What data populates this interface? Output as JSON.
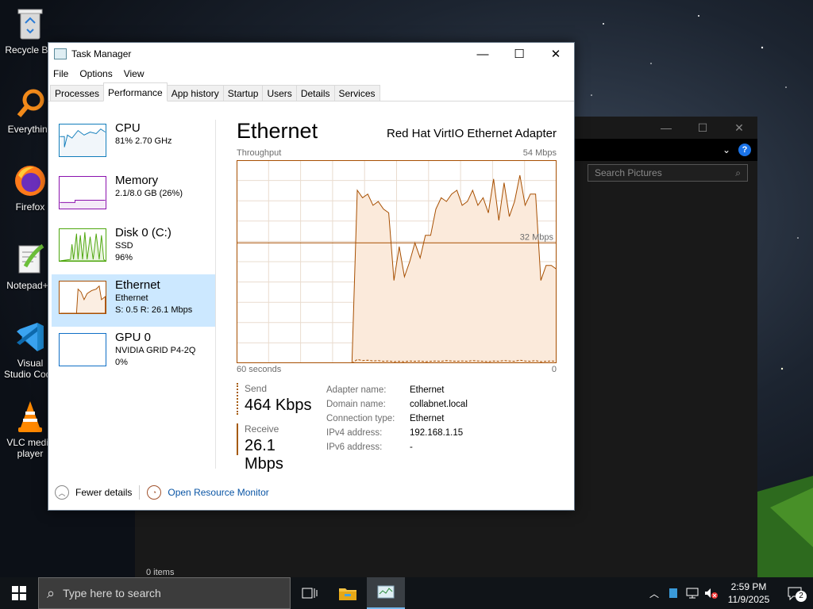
{
  "desktop": {
    "icons": [
      {
        "label": "Recycle Bin",
        "icon": "recycle-bin-icon"
      },
      {
        "label": "Everything",
        "icon": "everything-search-icon"
      },
      {
        "label": "Firefox",
        "icon": "firefox-icon"
      },
      {
        "label": "Notepad++",
        "icon": "notepad-plus-plus-icon"
      },
      {
        "label": "Visual Studio Code",
        "icon": "vscode-icon"
      },
      {
        "label": "VLC media player",
        "icon": "vlc-icon"
      }
    ]
  },
  "background_window": {
    "search_placeholder": "Search Pictures",
    "status": "0 items"
  },
  "task_manager": {
    "title": "Task Manager",
    "menu": [
      "File",
      "Options",
      "View"
    ],
    "tabs": [
      "Processes",
      "Performance",
      "App history",
      "Startup",
      "Users",
      "Details",
      "Services"
    ],
    "active_tab": "Performance",
    "sidebar": [
      {
        "name": "CPU",
        "line1": "81% 2.70 GHz",
        "line2": "",
        "color": "#117dbb"
      },
      {
        "name": "Memory",
        "line1": "2.1/8.0 GB (26%)",
        "line2": "",
        "color": "#8b12ae"
      },
      {
        "name": "Disk 0 (C:)",
        "line1": "SSD",
        "line2": "96%",
        "color": "#4da60c"
      },
      {
        "name": "Ethernet",
        "line1": "Ethernet",
        "line2": "S: 0.5 R: 26.1 Mbps",
        "color": "#a74f01"
      },
      {
        "name": "GPU 0",
        "line1": "NVIDIA GRID P4-2Q",
        "line2": "0%",
        "color": "#0f6fc6"
      }
    ],
    "main": {
      "title": "Ethernet",
      "adapter": "Red Hat VirtIO Ethernet Adapter",
      "y_label": "Throughput",
      "y_max": "54 Mbps",
      "mid_label": "32 Mbps",
      "x_left": "60 seconds",
      "x_right": "0",
      "send_label": "Send",
      "send_value": "464 Kbps",
      "receive_label": "Receive",
      "receive_value": "26.1 Mbps",
      "properties": [
        {
          "key": "Adapter name:",
          "value": "Ethernet"
        },
        {
          "key": "Domain name:",
          "value": "collabnet.local"
        },
        {
          "key": "Connection type:",
          "value": "Ethernet"
        },
        {
          "key": "IPv4 address:",
          "value": "192.168.1.15"
        },
        {
          "key": "IPv6 address:",
          "value": "-"
        }
      ]
    },
    "footer": {
      "fewer": "Fewer details",
      "resmon": "Open Resource Monitor"
    }
  },
  "taskbar": {
    "search_placeholder": "Type here to search",
    "time": "2:59 PM",
    "date": "11/9/2025",
    "notifications": "2"
  },
  "chart_data": {
    "type": "line",
    "title": "Throughput",
    "xlabel": "60 seconds",
    "ylim": [
      0,
      54
    ],
    "x": [
      60,
      58,
      57,
      56,
      55,
      54,
      53,
      52,
      51,
      50,
      49,
      48,
      47,
      46,
      45,
      44,
      43,
      42,
      41,
      40,
      39,
      38,
      37,
      36,
      35,
      34,
      33,
      32,
      31,
      30,
      29,
      28,
      27,
      26,
      25,
      24,
      23,
      22,
      21,
      20,
      19,
      18,
      17,
      16,
      15,
      14,
      13,
      12,
      11,
      10,
      9,
      8,
      7,
      6,
      5,
      4,
      3,
      2,
      1,
      0
    ],
    "series": [
      {
        "values": [
          0,
          0,
          0,
          0,
          0,
          0,
          0,
          0,
          0,
          0,
          0,
          0,
          0,
          0,
          0,
          0,
          0,
          0,
          0,
          0,
          0,
          0,
          0,
          46,
          44,
          45,
          42,
          43,
          41,
          40,
          22,
          31,
          23,
          27,
          32,
          28,
          34,
          34,
          41,
          44,
          43,
          45,
          46,
          42,
          43,
          46,
          42,
          44,
          40,
          49,
          38,
          48,
          39,
          43,
          50,
          42,
          45,
          45,
          22,
          26,
          26,
          25
        ]
      },
      {
        "values": [
          0,
          0,
          0,
          0,
          0,
          0,
          0,
          0,
          0,
          0,
          0,
          0,
          0,
          0,
          0,
          0,
          0,
          0,
          0,
          0,
          0,
          0,
          0,
          1,
          0.7,
          0.8,
          0.6,
          0.7,
          0.5,
          0.6,
          0.4,
          0.5,
          0.4,
          0.6,
          0.5,
          0.6,
          0.4,
          0.5,
          0.6,
          0.5,
          0.7,
          0.6,
          0.5,
          0.6,
          0.5,
          0.7,
          0.6,
          0.5,
          0.4,
          0.6,
          0.5,
          0.7,
          0.6,
          0.5,
          0.8,
          0.6,
          0.5,
          0.7,
          0.4,
          0.5,
          0.6,
          0.5
        ]
      }
    ]
  }
}
